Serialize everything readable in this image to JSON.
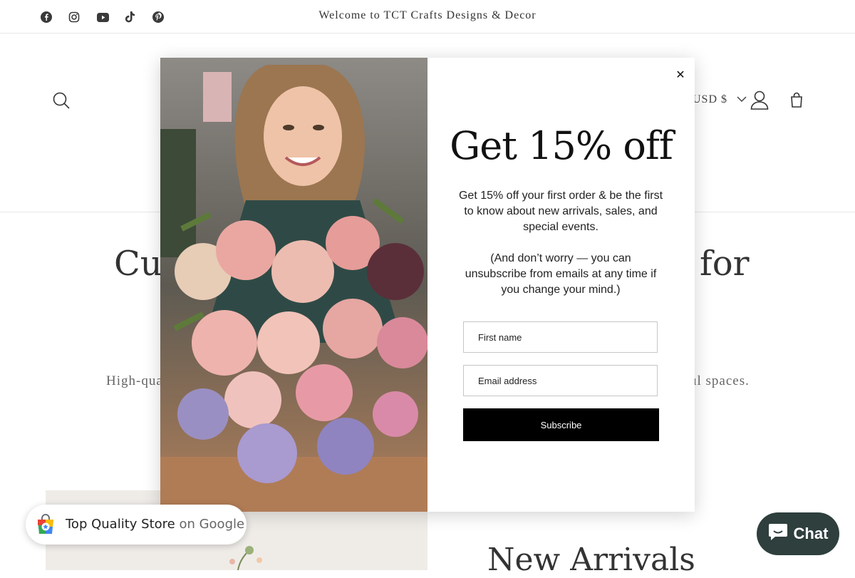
{
  "announcement": {
    "text": "Welcome to TCT Crafts Designs & Decor"
  },
  "social_icons": [
    "facebook-icon",
    "instagram-icon",
    "youtube-icon",
    "tiktok-icon",
    "pinterest-icon"
  ],
  "header": {
    "currency": "USD $"
  },
  "hero": {
    "title_left": "Cur",
    "title_right": "for",
    "subtitle_left": "High-qua",
    "subtitle_right": "ul spaces."
  },
  "section": {
    "title": "New Arrivals"
  },
  "popup": {
    "title": "Get 15% off",
    "body_1": "Get 15% off your first order & be the first to know about new arrivals, sales, and special events.",
    "body_2": "(And don’t worry — you can unsubscribe from emails at any time if you change your mind.)",
    "first_name_placeholder": "First name",
    "email_placeholder": "Email address",
    "subscribe_label": "Subscribe",
    "close_glyph": "✕"
  },
  "google_badge": {
    "text": "Top Quality Store",
    "suffix": "on Google"
  },
  "chat": {
    "label": "Chat"
  },
  "colors": {
    "chat_bg": "#2e3f3d",
    "button_bg": "#000000"
  }
}
